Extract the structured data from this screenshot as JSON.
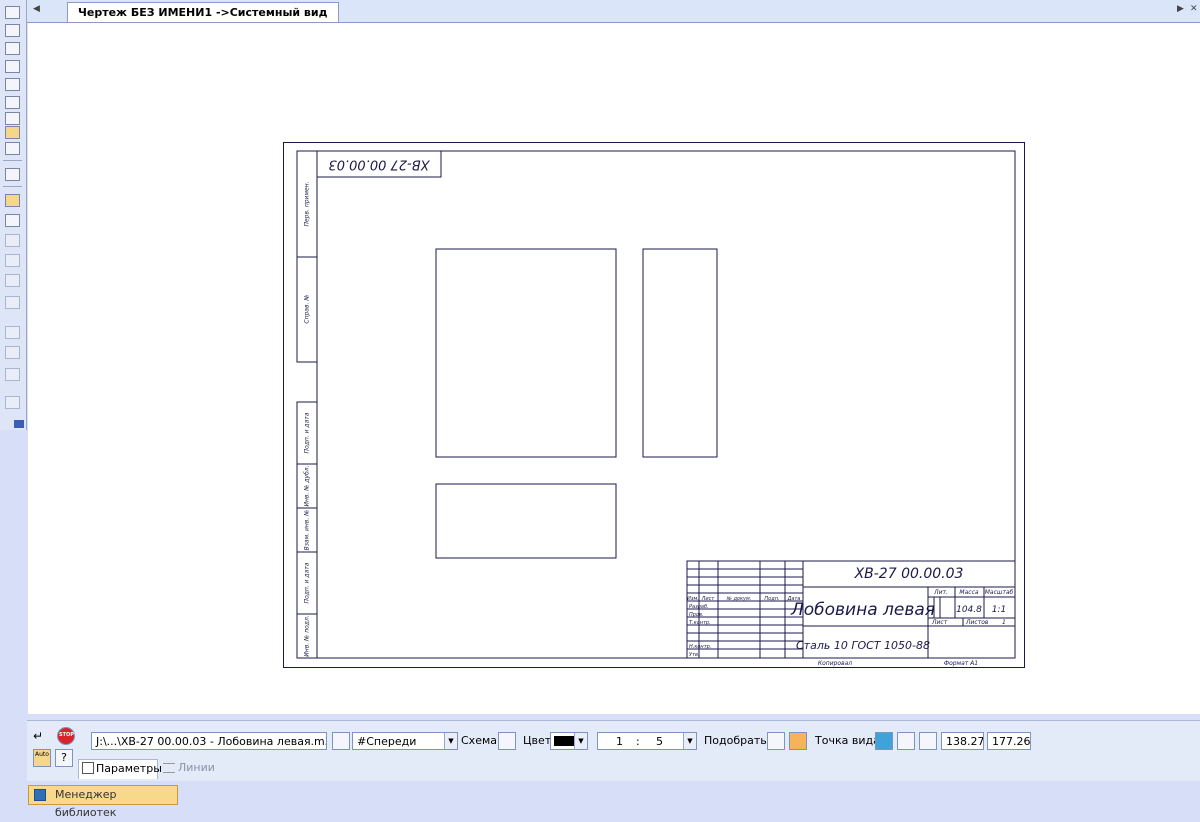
{
  "window": {
    "tab_title": "Чертеж БЕЗ ИМЕНИ1 ->Системный вид"
  },
  "drawing": {
    "top_code": "ХВ-27 00.00.03",
    "tb_code": "ХВ-27 00.00.03",
    "part_name": "Лобовина левая",
    "material": "Сталь 10 ГОСТ 1050-88",
    "mass": "104.8",
    "scale": "1:1",
    "lit_hdr": "Лит.",
    "mass_hdr": "Масса",
    "scale_hdr": "Масштаб",
    "sheet_lbl": "Лист",
    "sheets_lbl": "Листов",
    "sheets_val": "1",
    "copied": "Копировал",
    "format": "Формат  А1",
    "col_heads": [
      "Изм.",
      "Лист",
      "№ докум.",
      "Подп.",
      "Дата"
    ],
    "row_heads": [
      "Разраб.",
      "Пров.",
      "Т.контр.",
      "",
      "Н.контр.",
      "Утв."
    ],
    "side_labels": [
      "Перв. примен.",
      "Справ. №",
      "Подп. и дата",
      "Инв. № дубл.",
      "Взам. инв. №",
      "Подп. и дата",
      "Инв. № подл."
    ]
  },
  "panel": {
    "file_path": "J:\\...\\ХВ-27 00.00.03 - Лобовина левая.m3d",
    "view": "#Спереди",
    "scheme_label": "Схема",
    "color_label": "Цвет",
    "scale_a": "1",
    "scale_sep": ":",
    "scale_b": "5",
    "fit_label": "Подобрать",
    "point_label": "Точка вида",
    "x": "138.27",
    "y": "177.26",
    "auto_label": "Auto",
    "stop_label": "STOP",
    "tab_params": "Параметры",
    "tab_lines": "Линии"
  },
  "statusbar": {
    "library_manager": "Менеджер библиотек"
  },
  "colors": {
    "line": "#1a1a4a",
    "panel_bg": "#e4ebf8",
    "accent": "#f7d98b"
  }
}
